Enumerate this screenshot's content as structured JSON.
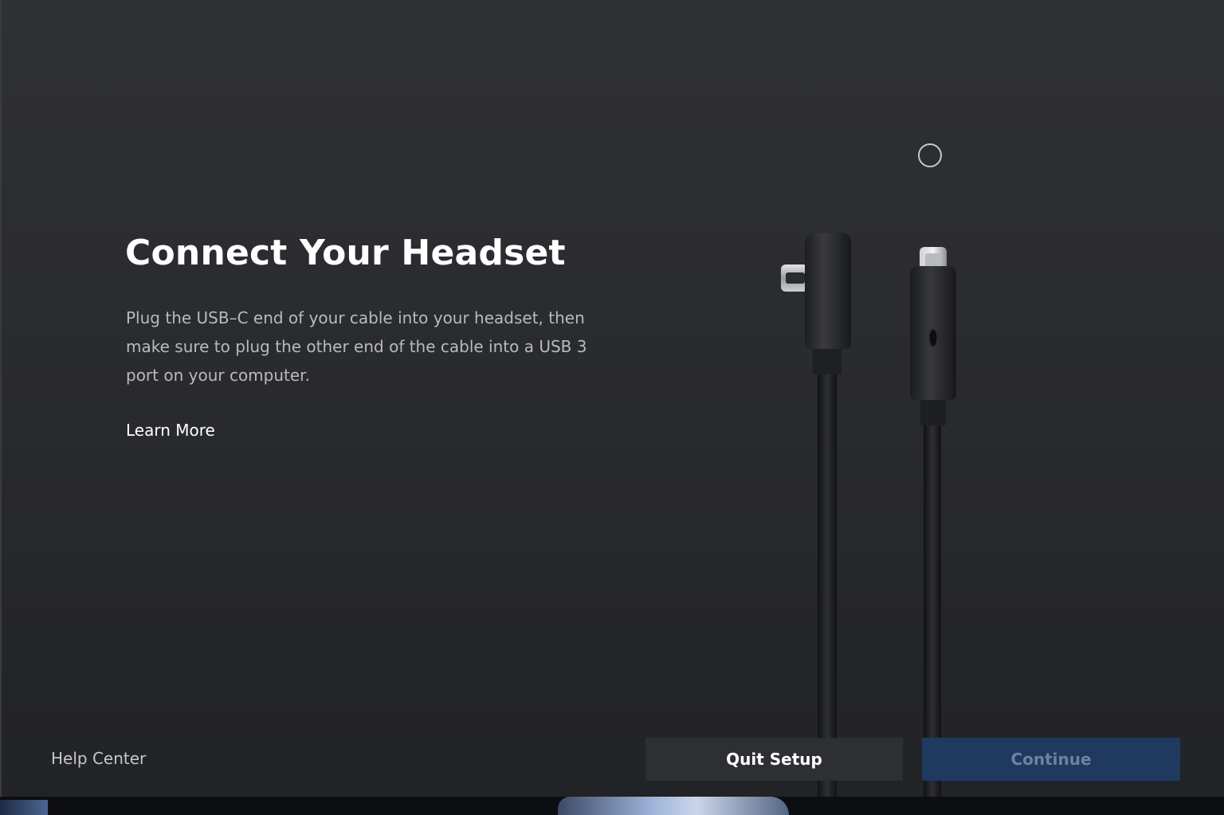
{
  "setup": {
    "title": "Connect Your Headset",
    "description": "Plug the USB–C end of your cable into your headset, then make sure to plug the other end of the cable into a USB 3 port on your computer.",
    "learn_more": "Learn More"
  },
  "footer": {
    "help_center": "Help Center",
    "quit_label": "Quit Setup",
    "continue_label": "Continue",
    "continue_enabled": false
  },
  "illustration": {
    "name": "usb-c-link-cable",
    "loading": true
  },
  "colors": {
    "background": "#2c2d30",
    "primary_button": "#1f3a5e",
    "secondary_button": "#2e2f33",
    "text_primary": "#ffffff",
    "text_secondary": "#b9babd"
  }
}
